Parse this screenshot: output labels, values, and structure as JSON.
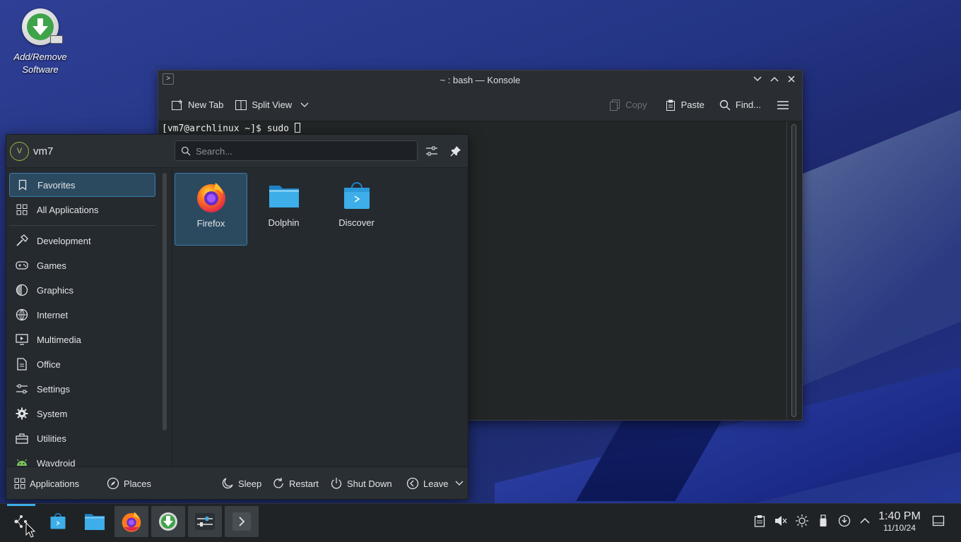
{
  "desktop": {
    "icons": [
      {
        "label": "Add/Remove\nSoftware"
      }
    ]
  },
  "konsole": {
    "title": "~ : bash — Konsole",
    "toolbar": {
      "new_tab": "New Tab",
      "split_view": "Split View",
      "copy": "Copy",
      "paste": "Paste",
      "find": "Find..."
    },
    "terminal": {
      "prompt": "[vm7@archlinux ~]$ sudo "
    }
  },
  "launcher": {
    "user": "vm7",
    "avatar_letter": "V",
    "search_placeholder": "Search...",
    "categories": [
      {
        "label": "Favorites",
        "icon": "bookmark-icon",
        "selected": true
      },
      {
        "label": "All Applications",
        "icon": "grid-icon"
      },
      {
        "label": "Development",
        "icon": "hammer-icon"
      },
      {
        "label": "Games",
        "icon": "gamepad-icon"
      },
      {
        "label": "Graphics",
        "icon": "graphics-icon"
      },
      {
        "label": "Internet",
        "icon": "globe-icon"
      },
      {
        "label": "Multimedia",
        "icon": "monitor-play-icon"
      },
      {
        "label": "Office",
        "icon": "document-icon"
      },
      {
        "label": "Settings",
        "icon": "sliders-icon"
      },
      {
        "label": "System",
        "icon": "gear-icon"
      },
      {
        "label": "Utilities",
        "icon": "toolbox-icon"
      },
      {
        "label": "Waydroid",
        "icon": "android-icon"
      }
    ],
    "apps": [
      {
        "label": "Firefox",
        "icon": "firefox-icon",
        "selected": true
      },
      {
        "label": "Dolphin",
        "icon": "folder-icon"
      },
      {
        "label": "Discover",
        "icon": "discover-icon"
      }
    ],
    "footer": {
      "applications": "Applications",
      "places": "Places",
      "sleep": "Sleep",
      "restart": "Restart",
      "shutdown": "Shut Down",
      "leave": "Leave"
    }
  },
  "taskbar": {
    "time": "1:40 PM",
    "date": "11/10/24"
  },
  "colors": {
    "accent": "#3daee9",
    "panel": "#202326",
    "window": "#232629"
  }
}
